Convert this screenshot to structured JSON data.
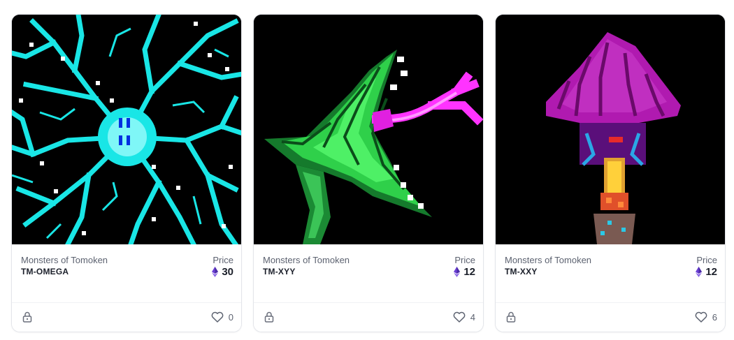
{
  "colors": {
    "card_border": "#e3e5ea",
    "title_text": "#1b1f2a",
    "muted_text": "#5c6270",
    "eth_purple": "#6b3fd4"
  },
  "cards": [
    {
      "collection": "Monsters of Tomoken",
      "token": "TM-OMEGA",
      "price_label": "Price",
      "price": "30",
      "currency_icon": "ethereum-icon",
      "likes": "0",
      "lock_icon": "lock-icon",
      "like_icon": "heart-icon",
      "art": "cyan neuron pixel art"
    },
    {
      "collection": "Monsters of Tomoken",
      "token": "TM-XYY",
      "price_label": "Price",
      "price": "12",
      "currency_icon": "ethereum-icon",
      "likes": "4",
      "lock_icon": "lock-icon",
      "like_icon": "heart-icon",
      "art": "green dragon pixel art"
    },
    {
      "collection": "Monsters of Tomoken",
      "token": "TM-XXY",
      "price_label": "Price",
      "price": "12",
      "currency_icon": "ethereum-icon",
      "likes": "6",
      "lock_icon": "lock-icon",
      "like_icon": "heart-icon",
      "art": "purple mushroom pixel art"
    }
  ]
}
